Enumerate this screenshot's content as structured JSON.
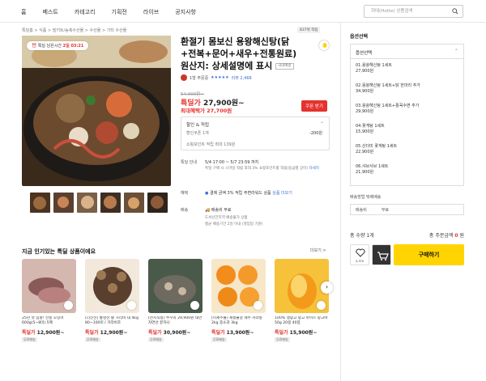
{
  "nav": {
    "items": [
      "홈",
      "베스트",
      "카테고리",
      "기획전",
      "라이브",
      "공지사항"
    ],
    "search_placeholder": "히테(Hotte) 상품검색"
  },
  "breadcrumb": "특딜홈 > 식품 > 밀키트/농축수산물 > 수산물 > 기타 수산물",
  "timer": {
    "label": "특딜 남은시간",
    "value": "2일 03:21"
  },
  "product": {
    "best_badge": "837위 적립",
    "title": "환절기 몸보신 용왕해신탕(닭+전복+문어+새우+전통원료) 원산지: 상세설명에 표시",
    "domestic": "국내배송",
    "seller": "1형 주문중",
    "stars": "★★★★★",
    "reviews": "리뷰 2,468",
    "orig_price": "54,900원~",
    "sale_label": "특딜가",
    "sale_price": "27,900원~",
    "max_benefit": "최대혜택가 27,700원",
    "coupon": "쿠폰 받기",
    "discount": {
      "title": "할인 & 적립",
      "row_label": "할인쿠폰 1개",
      "row_value": "-200원",
      "points": "쇼핑포인트 적립 최대 139원"
    },
    "delivery": {
      "label": "특딜 안내",
      "value": "5/4 17:00 ~ 5/7 23:59 까지",
      "note": "특딜 구매 시 스마일 적립 최대 3% 쇼핑포인트를 적립(등급별 상이)",
      "detail": "자세히"
    },
    "benefit": {
      "label": "혜택",
      "value": "결제 금액 3% 적립 주면라워드 상품",
      "link": "상품 더보기"
    },
    "ship": {
      "label": "배송",
      "value": "배송비 무료",
      "note1": "도서산간지역 배송불가 상품",
      "note2": "평균 배송기간 2일 이내 (영업일 기준)"
    }
  },
  "popular": {
    "title": "지금 인기있는 특딜 상품이에요",
    "more": "더보기 >",
    "items": [
      {
        "title": "25년 첫 입항! 선동 오징어 600g(5~8미) 5팩",
        "label": "특딜가",
        "price": "12,900원~",
        "chip": "무료배송"
      },
      {
        "title": "[더신선] 통영산 활 거리비 대 4kg 80~100미 / 거리비조",
        "label": "특딜가",
        "price": "12,900원~",
        "chip": "무료배송"
      },
      {
        "title": "[산지직송] 쭈꾸미 29,900원 태안 자연산 끝하나",
        "label": "특딜가",
        "price": "30,900원~",
        "chip": "무료배송"
      },
      {
        "title": "[이제주몰] 제철불굴 제주 카라향 2kg 중소과 3kg",
        "label": "특딜가",
        "price": "13,900원~",
        "chip": "무료배송"
      },
      {
        "title": "100% 생망고 망고 아이스 망고바 50g 20봉 40봉",
        "label": "특딜가",
        "price": "15,900원~",
        "chip": "무료배송"
      }
    ]
  },
  "options": {
    "title": "옵션선택",
    "selected": "옵션선택",
    "items": [
      {
        "name": "01.용왕해신탕 1세트",
        "price": "27,900원"
      },
      {
        "name": "02.용왕해신탕 1세트+닭 한마리 추가",
        "price": "34,900원"
      },
      {
        "name": "03.용왕해신탕 1세트+활꼭수면 추가",
        "price": "29,900원"
      },
      {
        "name": "04.꽃게탕 1세트",
        "price": "15,900원"
      },
      {
        "name": "05.산더미 꽃게탕 1세트",
        "price": "22,900원"
      },
      {
        "name": "06.샤브샤브 1세트",
        "price": "21,900원"
      }
    ]
  },
  "shipping_method": {
    "label": "배송방법  택배배송",
    "k": "배송비",
    "v": "무료"
  },
  "totals": {
    "qty": "총 수량 1개",
    "amount_label": "총 주문금액",
    "amount": "0",
    "unit": "원"
  },
  "actions": {
    "like": "5,370",
    "buy": "구매하기"
  }
}
